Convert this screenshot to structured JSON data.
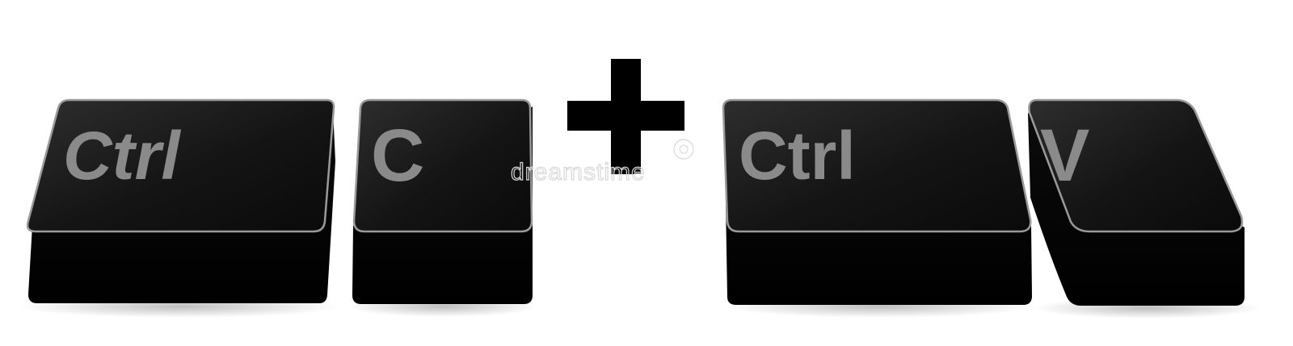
{
  "keys": {
    "ctrl_left": {
      "label": "Ctrl"
    },
    "c": {
      "label": "C"
    },
    "ctrl_right": {
      "label": "Ctrl"
    },
    "v": {
      "label": "V"
    }
  },
  "plus_symbol": "+",
  "watermark": "dreamstime",
  "colors": {
    "key_top": "#1a1a1a",
    "key_side": "#000000",
    "key_rim": "#9a9a9a",
    "label": "#8a8a8a",
    "plus": "#000000",
    "background": "#ffffff"
  },
  "icons": {
    "plus": "plus-icon"
  }
}
